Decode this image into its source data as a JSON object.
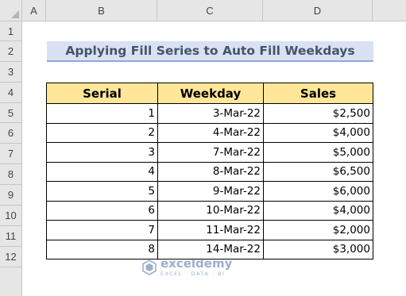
{
  "columns": [
    "A",
    "B",
    "C",
    "D"
  ],
  "rows": [
    "1",
    "2",
    "3",
    "4",
    "5",
    "6",
    "7",
    "8",
    "9",
    "10",
    "11",
    "12"
  ],
  "title": "Applying Fill Series to Auto Fill Weekdays",
  "table": {
    "headers": [
      "Serial",
      "Weekday",
      "Sales"
    ],
    "rows": [
      {
        "serial": "1",
        "weekday": "3-Mar-22",
        "sales": "$2,500"
      },
      {
        "serial": "2",
        "weekday": "4-Mar-22",
        "sales": "$4,000"
      },
      {
        "serial": "3",
        "weekday": "7-Mar-22",
        "sales": "$5,000"
      },
      {
        "serial": "4",
        "weekday": "8-Mar-22",
        "sales": "$6,500"
      },
      {
        "serial": "5",
        "weekday": "9-Mar-22",
        "sales": "$6,000"
      },
      {
        "serial": "6",
        "weekday": "10-Mar-22",
        "sales": "$4,000"
      },
      {
        "serial": "7",
        "weekday": "11-Mar-22",
        "sales": "$2,000"
      },
      {
        "serial": "8",
        "weekday": "14-Mar-22",
        "sales": "$3,000"
      }
    ]
  },
  "watermark": {
    "name": "exceldemy",
    "tagline": "EXCEL · DATA · BI",
    "color": "#4a6fa5"
  },
  "colors": {
    "header_fill": "#ffe699",
    "title_fill": "#d9e1f2",
    "title_text": "#44546a",
    "grid_header": "#e6e6e6"
  }
}
